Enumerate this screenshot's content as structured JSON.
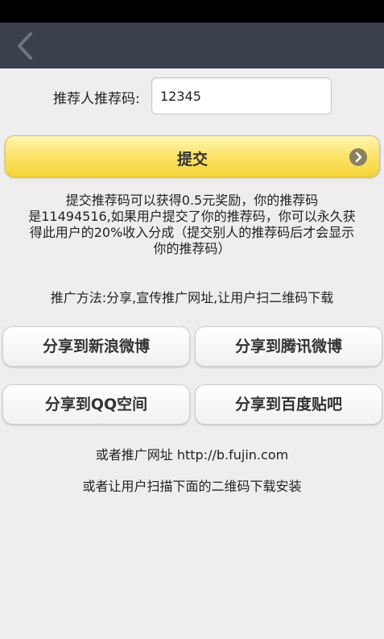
{
  "nav": {
    "back_icon": "chevron-left-icon"
  },
  "referrer": {
    "label": "推荐人推荐码:",
    "value": "12345"
  },
  "submit": {
    "label": "提交",
    "arrow_icon": "circle-arrow-right-icon"
  },
  "description": {
    "line1": "提交推荐码可以获得0.5元奖励，你的推荐码",
    "line2": "是11494516,如果用户提交了你的推荐码，你可以永久获",
    "line3": "得此用户的20%收入分成（提交别人的推荐码后才会显示",
    "line4": "你的推荐码）"
  },
  "promo_method": "推广方法:分享,宣传推广网址,让用户扫二维码下载",
  "share": {
    "sina_weibo": "分享到新浪微博",
    "tencent_weibo": "分享到腾讯微博",
    "qq_zone": "分享到QQ空间",
    "baidu_tieba": "分享到百度贴吧"
  },
  "promo_url_text": "或者推广网址 http://b.fujin.com",
  "qr_text": "或者让用户扫描下面的二维码下载安装",
  "colors": {
    "nav_bg": "#3a404c",
    "submit_bg": "#fbe160",
    "page_bg": "#eeeeee"
  }
}
